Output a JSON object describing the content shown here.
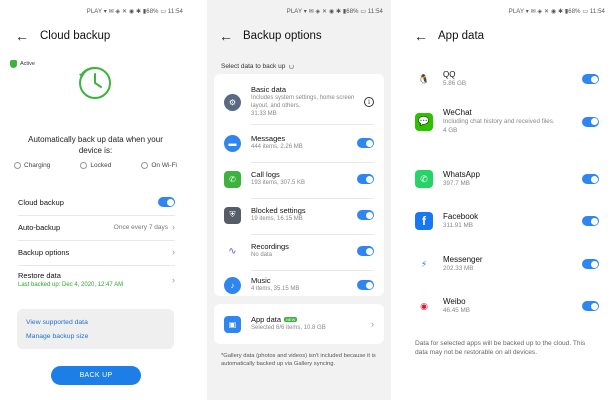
{
  "status_bar": {
    "time": "11:54",
    "battery": "68%",
    "carrier": "PLAY"
  },
  "screen1": {
    "title": "Cloud backup",
    "active_badge": "Active",
    "description": "Automatically back up data when your device is:",
    "conditions": [
      {
        "label": "Charging",
        "icon": "charging-icon"
      },
      {
        "label": "Locked",
        "icon": "lock-icon"
      },
      {
        "label": "On Wi-Fi",
        "icon": "wifi-icon"
      }
    ],
    "rows": {
      "cloud_backup": {
        "label": "Cloud backup",
        "enabled": true
      },
      "auto_backup": {
        "label": "Auto-backup",
        "value": "Once every 7 days"
      },
      "backup_options": {
        "label": "Backup options"
      },
      "restore_data": {
        "label": "Restore data",
        "sub": "Last backed up: Dec 4, 2020, 12:47 AM"
      }
    },
    "links": {
      "view_supported": "View supported data",
      "manage_size": "Manage backup size"
    },
    "backup_button": "BACK UP"
  },
  "screen2": {
    "title": "Backup options",
    "select_label": "Select data to back up",
    "items": [
      {
        "name": "Basic data",
        "sub": "Includes system settings, home screen layout, and others.",
        "size": "31.33 MB",
        "control": "info",
        "icon": "settings-icon",
        "color": "#5a6a82"
      },
      {
        "name": "Messages",
        "sub": "444 items, 2.26 MB",
        "control": "toggle",
        "enabled": true,
        "icon": "messages-icon",
        "color": "#2f86f0"
      },
      {
        "name": "Call logs",
        "sub": "193 items, 307.5 KB",
        "control": "toggle",
        "enabled": true,
        "icon": "phone-icon",
        "color": "#3db33d"
      },
      {
        "name": "Blocked settings",
        "sub": "19 items, 16.15 MB",
        "control": "toggle",
        "enabled": true,
        "icon": "shield-block-icon",
        "color": "#555d68"
      },
      {
        "name": "Recordings",
        "sub": "No data",
        "control": "toggle",
        "enabled": true,
        "icon": "waveform-icon",
        "color": "#7a4fe0"
      },
      {
        "name": "Music",
        "sub": "4 items, 35.15 MB",
        "control": "toggle",
        "enabled": true,
        "icon": "music-icon",
        "color": "#2f86f0"
      }
    ],
    "app_data": {
      "name": "App data",
      "badge": "NEW",
      "sub": "Selected 6/6 items, 10.8 GB"
    },
    "footnote": "*Gallery data (photos and videos) isn't included because it is automatically backed up via Gallery syncing."
  },
  "screen3": {
    "title": "App data",
    "apps": [
      {
        "name": "QQ",
        "sub": "5.86 GB",
        "enabled": true,
        "icon": "qq-icon",
        "color": "#ffffff",
        "glyph": "🐧"
      },
      {
        "name": "WeChat",
        "sub": "Including chat history and received files.",
        "sub2": "4 GB",
        "enabled": true,
        "icon": "wechat-icon",
        "color": "#2dc100",
        "glyph": "💬"
      },
      {
        "name": "WhatsApp",
        "sub": "397.7 MB",
        "enabled": true,
        "icon": "whatsapp-icon",
        "color": "#25d366",
        "glyph": "✆"
      },
      {
        "name": "Facebook",
        "sub": "311.91 MB",
        "enabled": true,
        "icon": "facebook-icon",
        "color": "#1877f2",
        "glyph": "f"
      },
      {
        "name": "Messenger",
        "sub": "202.33 MB",
        "enabled": true,
        "icon": "messenger-icon",
        "color": "#ffffff",
        "glyph": "⚡"
      },
      {
        "name": "Weibo",
        "sub": "46.45 MB",
        "enabled": true,
        "icon": "weibo-icon",
        "color": "#ffffff",
        "glyph": "◉"
      }
    ],
    "footnote": "Data for selected apps will be backed up to the cloud. This data may not be restorable on all devices."
  }
}
